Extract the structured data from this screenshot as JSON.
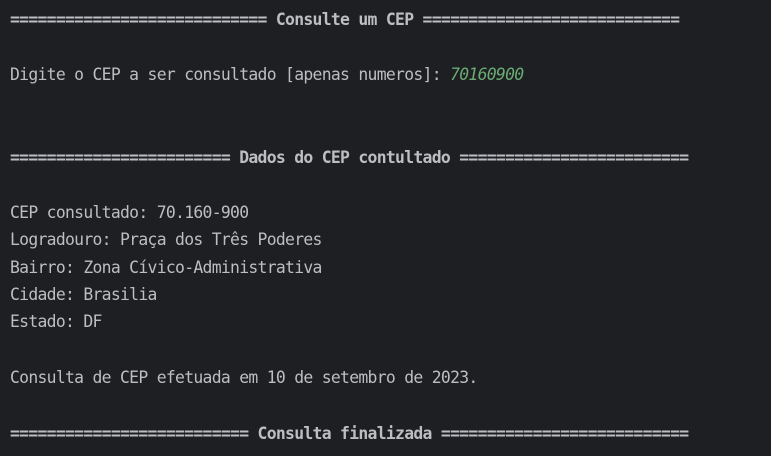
{
  "console": {
    "header_line": "============================ Consulte um CEP ============================",
    "prompt": {
      "label": "Digite o CEP a ser consultado [apenas numeros]: ",
      "user_input": "70160900"
    },
    "results_header": "======================== Dados do CEP contultado =========================",
    "results": [
      "CEP consultado: 70.160-900",
      "Logradouro: Praça dos Três Poderes",
      "Bairro: Zona Cívico-Administrativa",
      "Cidade: Brasilia",
      "Estado: DF"
    ],
    "summary": "Consulta de CEP efetuada em 10 de setembro de 2023.",
    "footer_line": "========================== Consulta finalizada ==========================="
  },
  "colors": {
    "background": "#1e1f22",
    "text": "#bcbec4",
    "user_input": "#6aab73"
  }
}
